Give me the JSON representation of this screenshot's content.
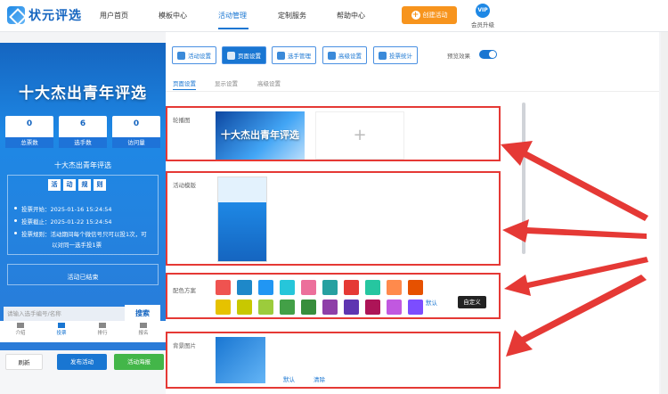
{
  "brand": {
    "name": "状元评选"
  },
  "nav": {
    "items": [
      "用户首页",
      "模板中心",
      "活动管理",
      "定制服务",
      "帮助中心"
    ],
    "active_index": 2,
    "create_label": "创建活动",
    "vip_badge": "VIP",
    "vip_label": "会员升级"
  },
  "preview": {
    "title": "十大杰出青年评选",
    "stats": [
      {
        "value": "0",
        "label": "总票数"
      },
      {
        "value": "6",
        "label": "选手数"
      },
      {
        "value": "0",
        "label": "访问量"
      }
    ],
    "activity_name": "十大杰出青年评选",
    "rules_chars": [
      "活",
      "动",
      "规",
      "则"
    ],
    "rules": [
      "投票开始：2025-01-16 15:24:54",
      "投票截止：2025-01-22 15:24:54",
      "投票规则：活动期间每个微信号只可以投1次，可",
      "以对同一选手投1票"
    ],
    "ended": "活动已结束",
    "search_placeholder": "请输入选手编号/名称",
    "search_button": "搜索",
    "tabs": [
      "介绍",
      "投票",
      "排行",
      "报名"
    ],
    "active_tab": 1
  },
  "actions": {
    "refresh": "刷新",
    "publish": "发布活动",
    "poster": "活动海报"
  },
  "toolbar": {
    "buttons": [
      "活动设置",
      "页面设置",
      "选手管理",
      "高级设置",
      "投票统计"
    ],
    "active_index": 1,
    "preview_label": "预览效果"
  },
  "subtabs": [
    "页面设置",
    "显示设置",
    "高级设置"
  ],
  "sections": {
    "carousel": {
      "label": "轮播图",
      "image_text": "十大杰出青年评选",
      "add": "+"
    },
    "template": {
      "label": "活动模版"
    },
    "colors": {
      "label": "配色方案",
      "swatches": [
        "#ef5350",
        "#1e88c9",
        "#2196f3",
        "#26c6da",
        "#ec6f9b",
        "#26a0a0",
        "#e53935",
        "#26c6a0",
        "#ff8a4c",
        "#e65100",
        "#e6c200",
        "#c8c800",
        "#9ccc3c",
        "#43a047",
        "#388e3c",
        "#8e3fa8",
        "#5e35b1",
        "#ad1457",
        "#c158e0",
        "#7c4dff"
      ],
      "default_label": "默认",
      "custom_label": "自定义"
    },
    "background": {
      "label": "背景图片",
      "default_label": "默认",
      "clear_label": "清除"
    }
  },
  "colors": {
    "accent": "#1976d2",
    "highlight": "#e53935",
    "create": "#f7941d",
    "poster": "#43b649"
  }
}
